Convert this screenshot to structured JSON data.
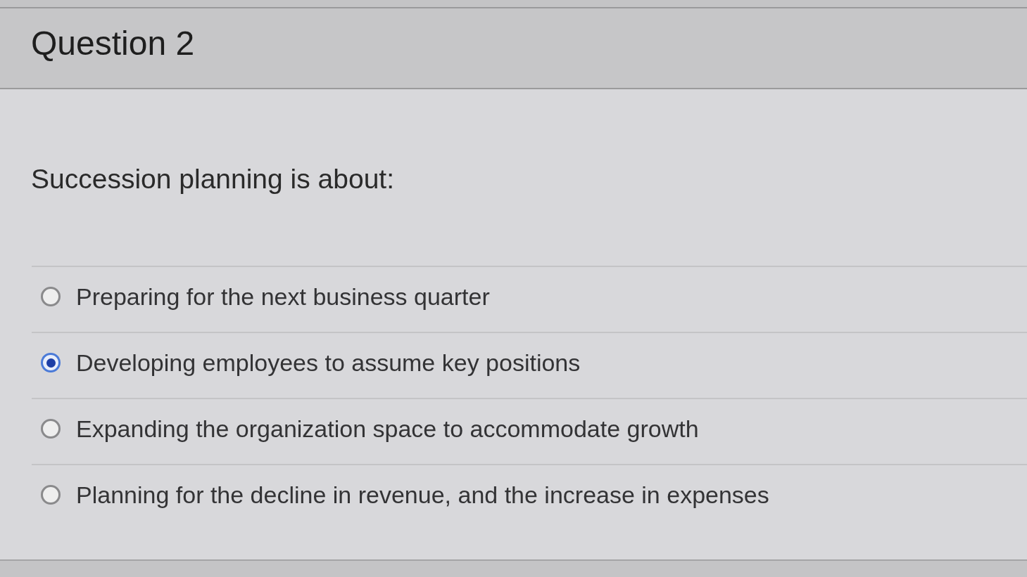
{
  "question": {
    "title": "Question 2",
    "prompt": "Succession planning is about:",
    "options": [
      {
        "label": "Preparing for the next business quarter",
        "selected": false
      },
      {
        "label": "Developing employees to assume key positions",
        "selected": true
      },
      {
        "label": "Expanding the organization space to accommodate growth",
        "selected": false
      },
      {
        "label": "Planning for the decline in revenue, and the increase in expenses",
        "selected": false
      }
    ]
  }
}
